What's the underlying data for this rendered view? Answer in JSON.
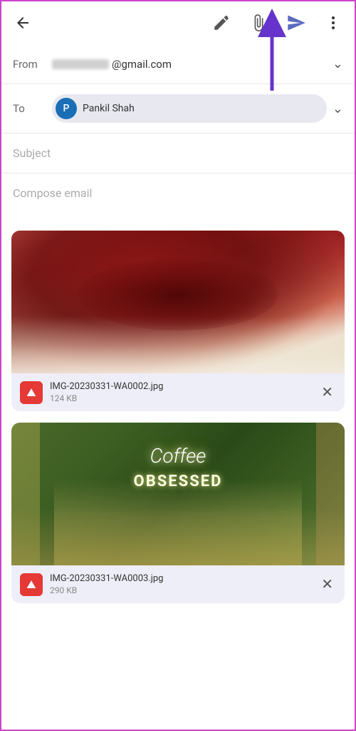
{
  "toolbar": {
    "back_label": "←",
    "edit_label": "edit",
    "attach_label": "attach",
    "send_label": "send",
    "more_label": "more"
  },
  "from_field": {
    "label": "From",
    "email_suffix": "@gmail.com"
  },
  "to_field": {
    "label": "To",
    "recipient": {
      "initial": "P",
      "name": "Pankil Shah"
    }
  },
  "subject_field": {
    "label": "Subject",
    "placeholder": "Subject"
  },
  "compose_field": {
    "placeholder": "Compose email"
  },
  "attachments": [
    {
      "filename": "IMG-20230331-WA0002.jpg",
      "size": "124 KB",
      "type": "image"
    },
    {
      "filename": "IMG-20230331-WA0003.jpg",
      "size": "290 KB",
      "type": "image"
    }
  ],
  "colors": {
    "accent": "#5c2d91",
    "arrow": "#6633cc",
    "avatar_bg": "#1a6eb5"
  }
}
